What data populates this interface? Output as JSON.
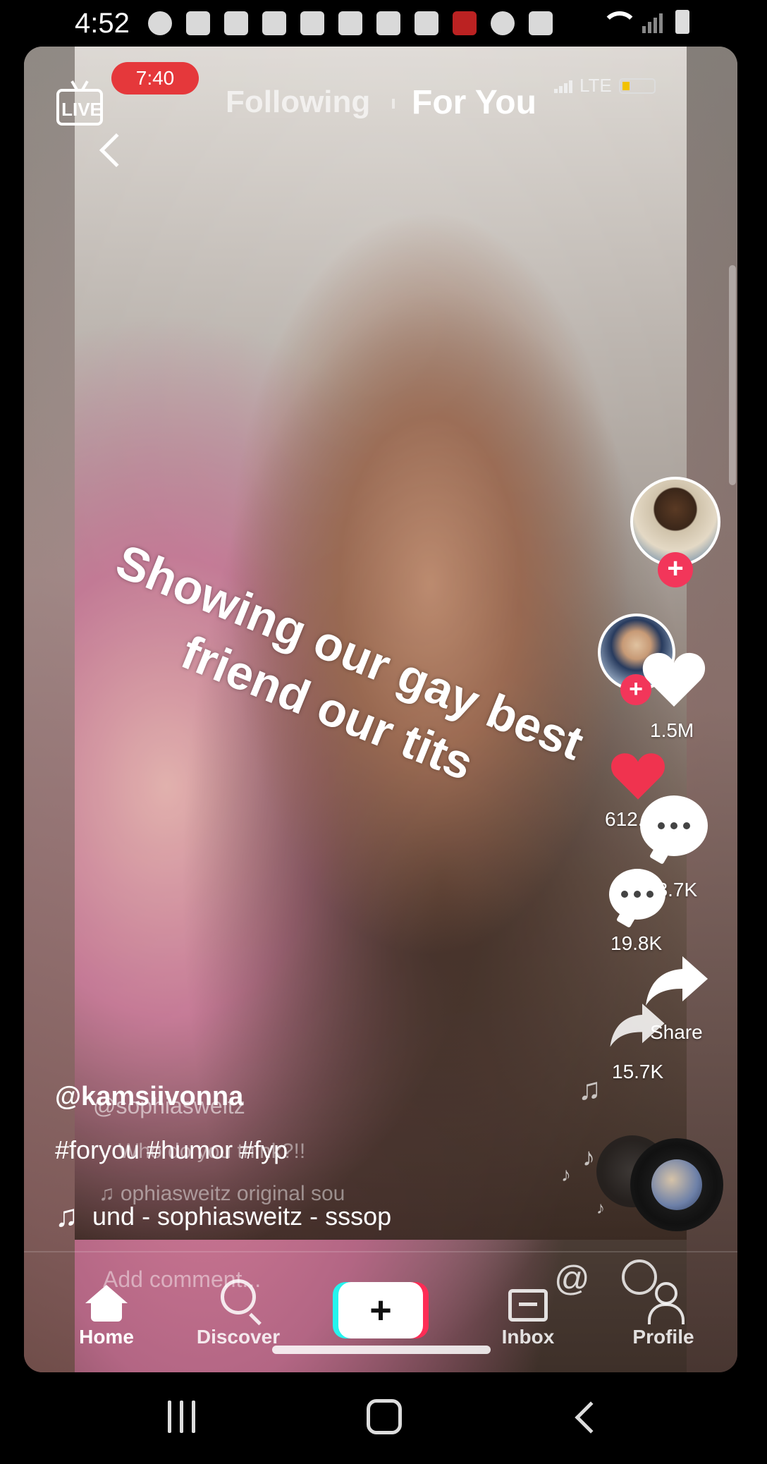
{
  "status_bar": {
    "time": "4:52",
    "icons": [
      "settings-icon",
      "badge-icon",
      "tiktok-icon",
      "tiktok-icon",
      "gmail-icon",
      "sprint-icon",
      "clock-app-icon",
      "gmail-icon",
      "stanford-icon",
      "star-icon",
      "incognito-icon",
      "dot-icon",
      "wifi-icon",
      "signal-icon",
      "battery-icon"
    ]
  },
  "top_nav": {
    "live_label": "LIVE",
    "timer": "7:40",
    "tab_following": "Following",
    "tab_for_you": "For You",
    "inner_network": "LTE"
  },
  "video": {
    "caption_line1": "Showing our gay best",
    "caption_line2": "friend our tits"
  },
  "rail": {
    "like_count_primary": "1.5M",
    "like_count_ghost": "612.3K",
    "comment_count_primary": "13.7K",
    "comment_count_ghost": "19.8K",
    "share_label": "Share",
    "share_count_ghost": "15.7K"
  },
  "post": {
    "username": "@kamsiivonna",
    "username_ghost": "@sophiasweitz",
    "hashtags": "#foryou #humor #fyp",
    "hashtags_ghost": "Who do you think?!!",
    "sound_ghost": "ophiasweitz    original sou",
    "sound": "und - sophiasweitz - sssop"
  },
  "comment_bar": {
    "placeholder": "Add comment..."
  },
  "tabbar": {
    "home": "Home",
    "discover": "Discover",
    "create": "+",
    "inbox": "Inbox",
    "profile": "Profile"
  },
  "colors": {
    "accent_red": "#fe2c55",
    "accent_cyan": "#25f4ee",
    "timer_pill": "#e5383b"
  }
}
